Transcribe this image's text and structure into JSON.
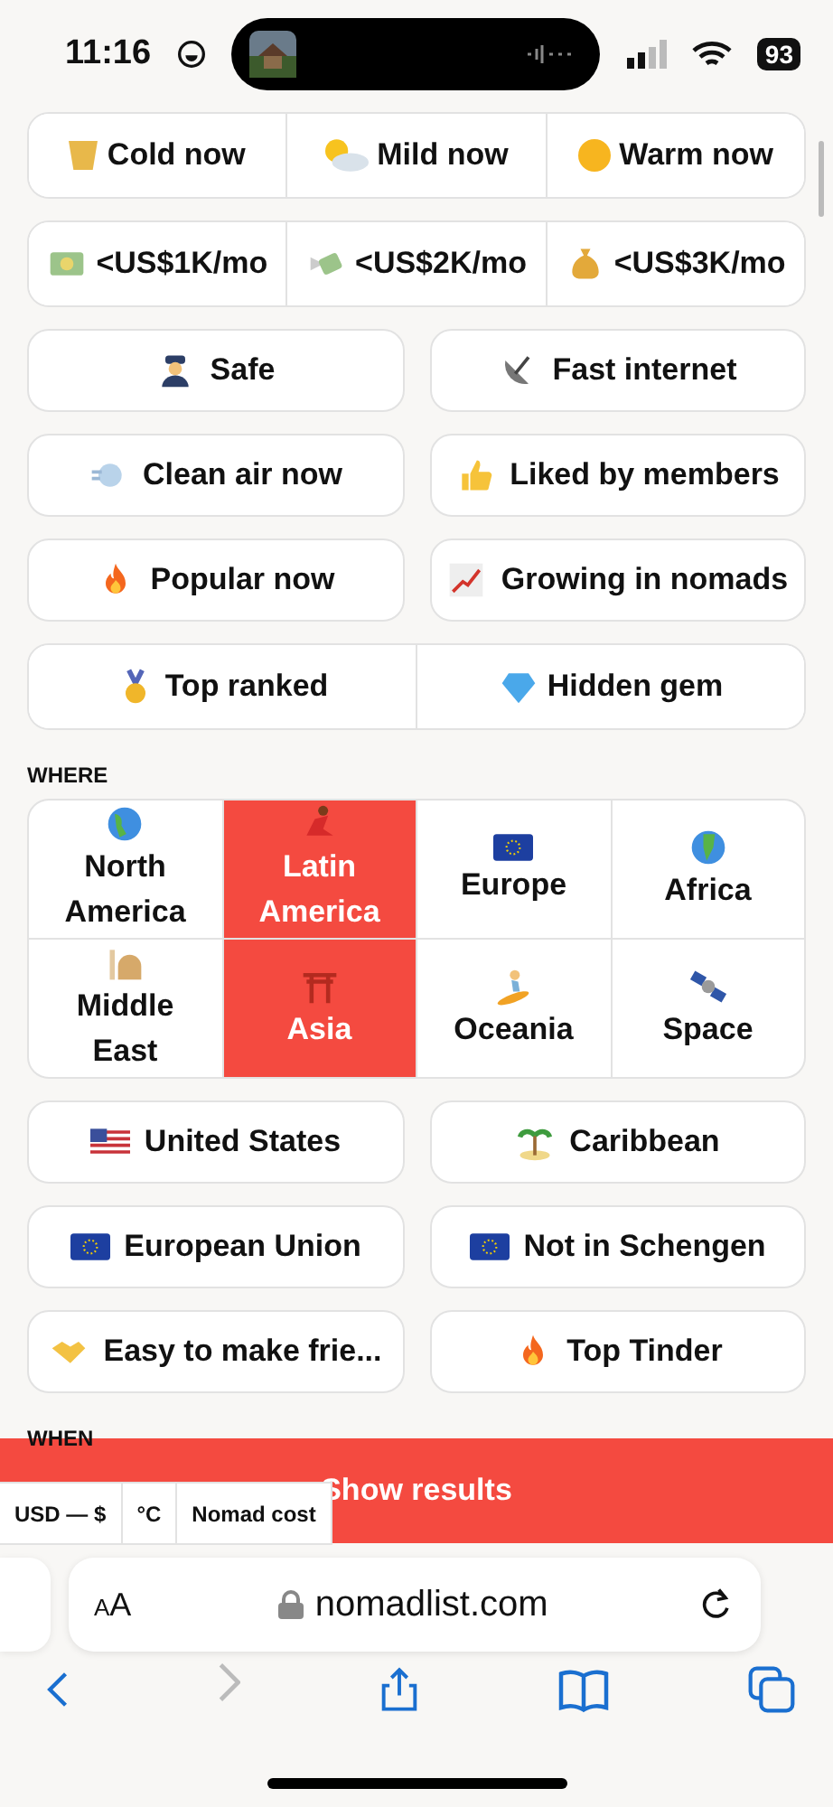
{
  "status_bar": {
    "time": "11:16",
    "battery": "93"
  },
  "filter_rows": [
    {
      "kind": "segmented",
      "items": [
        {
          "label": "Cold now",
          "selected": false
        },
        {
          "label": "Mild now",
          "selected": false
        },
        {
          "label": "Warm now",
          "selected": false
        }
      ]
    },
    {
      "kind": "segmented",
      "items": [
        {
          "label": "<US$1K/mo",
          "selected": false
        },
        {
          "label": "<US$2K/mo",
          "selected": false
        },
        {
          "label": "<US$3K/mo",
          "selected": false
        }
      ]
    },
    {
      "kind": "pair",
      "items": [
        {
          "label": "Safe",
          "selected": false
        },
        {
          "label": "Fast internet",
          "selected": false
        }
      ]
    },
    {
      "kind": "pair",
      "items": [
        {
          "label": "Clean air now",
          "selected": false
        },
        {
          "label": "Liked by members",
          "selected": false
        }
      ]
    },
    {
      "kind": "pair",
      "items": [
        {
          "label": "Popular now",
          "selected": false
        },
        {
          "label": "Growing in nomads",
          "selected": false
        }
      ]
    },
    {
      "kind": "segmented",
      "items": [
        {
          "label": "Top ranked",
          "selected": false
        },
        {
          "label": "Hidden gem",
          "selected": false
        }
      ]
    }
  ],
  "where": {
    "title": "WHERE",
    "regions": [
      {
        "label": "North America",
        "selected": false
      },
      {
        "label": "Latin America",
        "selected": true
      },
      {
        "label": "Europe",
        "selected": false
      },
      {
        "label": "Africa",
        "selected": false
      },
      {
        "label": "Middle East",
        "selected": false
      },
      {
        "label": "Asia",
        "selected": true
      },
      {
        "label": "Oceania",
        "selected": false
      },
      {
        "label": "Space",
        "selected": false
      }
    ],
    "rows": [
      {
        "kind": "pair",
        "items": [
          {
            "label": "United States",
            "selected": false
          },
          {
            "label": "Caribbean",
            "selected": false
          }
        ]
      },
      {
        "kind": "pair",
        "items": [
          {
            "label": "European Union",
            "selected": false
          },
          {
            "label": "Not in Schengen",
            "selected": false
          }
        ]
      },
      {
        "kind": "pair",
        "items": [
          {
            "label": "Easy to make frie...",
            "selected": false
          },
          {
            "label": "Top Tinder",
            "selected": false
          }
        ]
      }
    ]
  },
  "when": {
    "title": "WHEN"
  },
  "show_results": "Show results",
  "settings": [
    "USD — $",
    "°C",
    "Nomad cost"
  ],
  "browser": {
    "reader": "AA",
    "url": "nomadlist.com"
  }
}
